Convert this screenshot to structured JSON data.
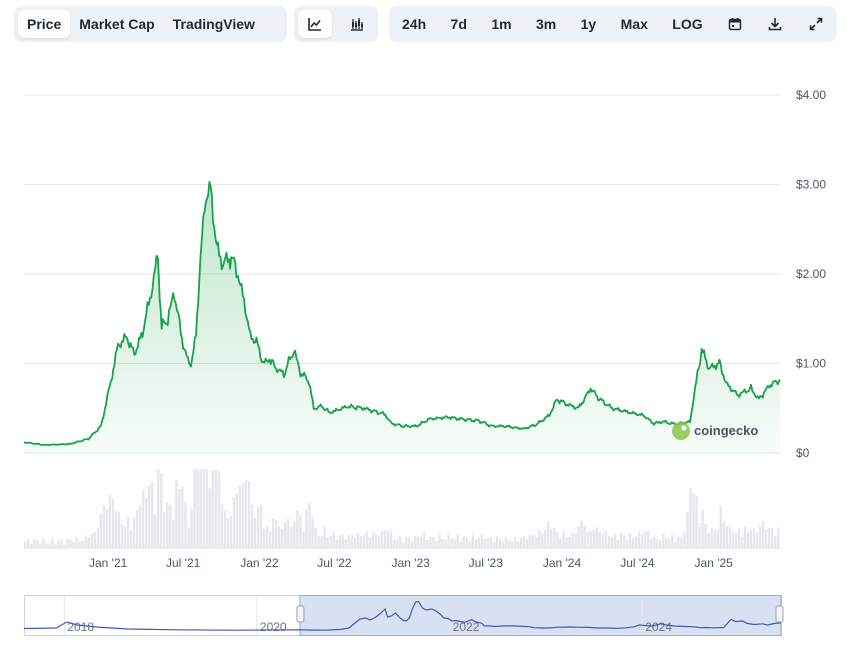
{
  "toolbar": {
    "view_tabs": [
      {
        "label": "Price",
        "active": true
      },
      {
        "label": "Market Cap",
        "active": false
      },
      {
        "label": "TradingView",
        "active": false
      }
    ],
    "chart_type_buttons": [
      {
        "icon": "line-chart-icon",
        "active": true
      },
      {
        "icon": "candlestick-chart-icon",
        "active": false
      }
    ],
    "ranges": [
      "24h",
      "7d",
      "1m",
      "3m",
      "1y",
      "Max",
      "LOG"
    ],
    "action_icons": [
      "calendar-icon",
      "download-icon",
      "expand-icon"
    ]
  },
  "watermark": "coingecko",
  "colors": {
    "line": "#16a34a",
    "area": "#16a34a",
    "volume": "#e5e7eb",
    "navigator_line": "#3b5bb5",
    "navigator_window": "#c9d3ec"
  },
  "chart_data": {
    "type": "area",
    "y_ticks": [
      "$0",
      "$1.00",
      "$2.00",
      "$3.00",
      "$4.00"
    ],
    "ylim": [
      0,
      4
    ],
    "x_ticks": [
      "Jan '21",
      "Jul '21",
      "Jan '22",
      "Jul '22",
      "Jan '23",
      "Jul '23",
      "Jan '24",
      "Jul '24",
      "Jan '25"
    ],
    "xlim": [
      "2020-06-12",
      "2025-06-10"
    ],
    "grid": true,
    "series": [
      {
        "points": [
          [
            "2020-06-12",
            0.12
          ],
          [
            "2020-08-01",
            0.09
          ],
          [
            "2020-10-01",
            0.1
          ],
          [
            "2020-11-15",
            0.16
          ],
          [
            "2020-12-15",
            0.3
          ],
          [
            "2021-01-05",
            0.75
          ],
          [
            "2021-01-25",
            1.2
          ],
          [
            "2021-02-15",
            1.3
          ],
          [
            "2021-03-05",
            1.1
          ],
          [
            "2021-03-25",
            1.35
          ],
          [
            "2021-04-15",
            1.8
          ],
          [
            "2021-05-01",
            2.2
          ],
          [
            "2021-05-10",
            1.4
          ],
          [
            "2021-05-25",
            1.5
          ],
          [
            "2021-06-10",
            1.8
          ],
          [
            "2021-06-25",
            1.35
          ],
          [
            "2021-07-10",
            1.05
          ],
          [
            "2021-07-20",
            1.0
          ],
          [
            "2021-08-01",
            1.3
          ],
          [
            "2021-08-12",
            2.2
          ],
          [
            "2021-08-25",
            2.9
          ],
          [
            "2021-09-05",
            2.95
          ],
          [
            "2021-09-20",
            2.3
          ],
          [
            "2021-10-05",
            2.1
          ],
          [
            "2021-10-25",
            2.2
          ],
          [
            "2021-11-10",
            2.0
          ],
          [
            "2021-11-25",
            1.7
          ],
          [
            "2021-12-10",
            1.3
          ],
          [
            "2021-12-25",
            1.25
          ],
          [
            "2022-01-10",
            1.0
          ],
          [
            "2022-01-25",
            1.05
          ],
          [
            "2022-02-10",
            0.95
          ],
          [
            "2022-03-01",
            0.88
          ],
          [
            "2022-03-25",
            1.15
          ],
          [
            "2022-04-10",
            0.9
          ],
          [
            "2022-05-01",
            0.8
          ],
          [
            "2022-05-12",
            0.5
          ],
          [
            "2022-06-01",
            0.52
          ],
          [
            "2022-06-20",
            0.45
          ],
          [
            "2022-08-01",
            0.52
          ],
          [
            "2022-09-10",
            0.5
          ],
          [
            "2022-11-01",
            0.43
          ],
          [
            "2022-11-15",
            0.33
          ],
          [
            "2022-12-15",
            0.3
          ],
          [
            "2023-01-15",
            0.3
          ],
          [
            "2023-02-15",
            0.38
          ],
          [
            "2023-04-01",
            0.4
          ],
          [
            "2023-05-01",
            0.38
          ],
          [
            "2023-06-15",
            0.36
          ],
          [
            "2023-07-15",
            0.3
          ],
          [
            "2023-08-15",
            0.3
          ],
          [
            "2023-10-01",
            0.27
          ],
          [
            "2023-11-01",
            0.32
          ],
          [
            "2023-12-01",
            0.42
          ],
          [
            "2023-12-20",
            0.6
          ],
          [
            "2024-01-10",
            0.55
          ],
          [
            "2024-02-10",
            0.5
          ],
          [
            "2024-03-10",
            0.72
          ],
          [
            "2024-04-01",
            0.6
          ],
          [
            "2024-05-01",
            0.5
          ],
          [
            "2024-06-15",
            0.45
          ],
          [
            "2024-07-15",
            0.42
          ],
          [
            "2024-08-10",
            0.33
          ],
          [
            "2024-09-01",
            0.35
          ],
          [
            "2024-10-01",
            0.32
          ],
          [
            "2024-11-05",
            0.35
          ],
          [
            "2024-11-20",
            0.8
          ],
          [
            "2024-12-03",
            1.15
          ],
          [
            "2024-12-20",
            0.95
          ],
          [
            "2025-01-15",
            1.0
          ],
          [
            "2025-02-03",
            0.75
          ],
          [
            "2025-03-01",
            0.65
          ],
          [
            "2025-04-01",
            0.72
          ],
          [
            "2025-04-20",
            0.6
          ],
          [
            "2025-05-15",
            0.75
          ],
          [
            "2025-06-10",
            0.82
          ]
        ]
      }
    ],
    "navigator": {
      "labels": [
        "2018",
        "2020",
        "2022",
        "2024"
      ],
      "window": [
        "2020-06-12",
        "2025-06-10"
      ]
    }
  }
}
